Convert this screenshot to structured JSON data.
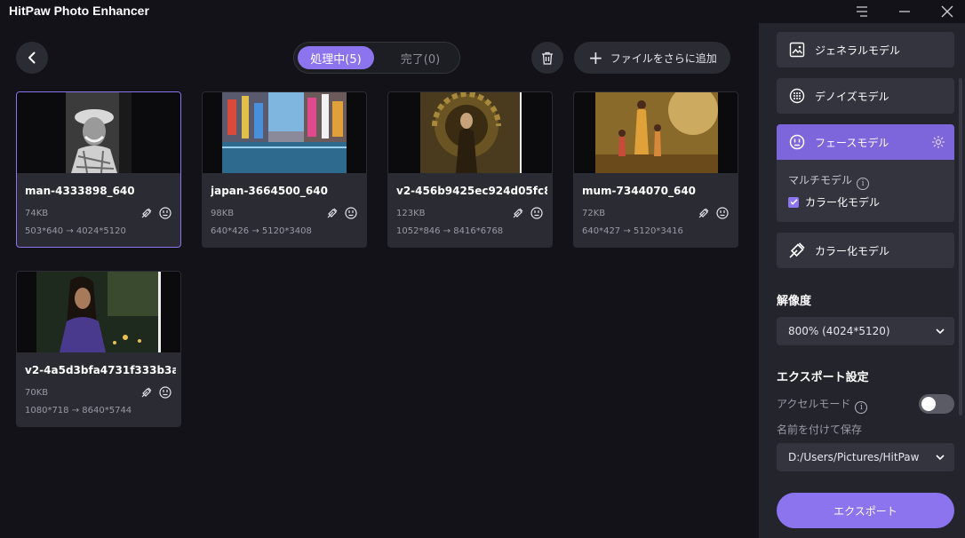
{
  "app": {
    "title": "HitPaw Photo Enhancer"
  },
  "toolbar": {
    "tab_processing": "処理中(5)",
    "tab_done": "完了(0)",
    "add_files_label": "ファイルをさらに追加"
  },
  "cards": [
    {
      "name": "man-4333898_640",
      "size": "74KB",
      "dims": "503*640 → 4024*5120"
    },
    {
      "name": "japan-3664500_640",
      "size": "98KB",
      "dims": "640*426 → 5120*3408"
    },
    {
      "name": "v2-456b9425ec924d05fc8...",
      "size": "123KB",
      "dims": "1052*846 → 8416*6768"
    },
    {
      "name": "mum-7344070_640",
      "size": "72KB",
      "dims": "640*427 → 5120*3416"
    },
    {
      "name": "v2-4a5d3bfa4731f333b3a...",
      "size": "70KB",
      "dims": "1080*718 → 8640*5744"
    }
  ],
  "panel": {
    "models": {
      "general": "ジェネラルモデル",
      "denoise": "デノイズモデル",
      "face": "フェースモデル",
      "multi_label": "マルチモデル",
      "colorize_check": "カラー化モデル",
      "colorize": "カラー化モデル"
    },
    "resolution_title": "解像度",
    "resolution_value": "800% (4024*5120)",
    "export_settings_title": "エクスポート設定",
    "accel_mode_label": "アクセルモード",
    "save_as_label": "名前を付けて保存",
    "save_path": "D:/Users/Pictures/HitPaw",
    "export_button": "エクスポート"
  },
  "colors": {
    "accent": "#8c74ef",
    "panel": "#24242c",
    "card": "#2b2b33",
    "background": "#121218"
  },
  "icons": [
    "menu-icon",
    "minimize-icon",
    "close-icon",
    "back-icon",
    "trash-icon",
    "plus-icon",
    "colorize-icon",
    "face-icon",
    "image-icon",
    "denoise-icon",
    "settings-icon",
    "info-icon",
    "check-icon",
    "chevron-down-icon"
  ]
}
